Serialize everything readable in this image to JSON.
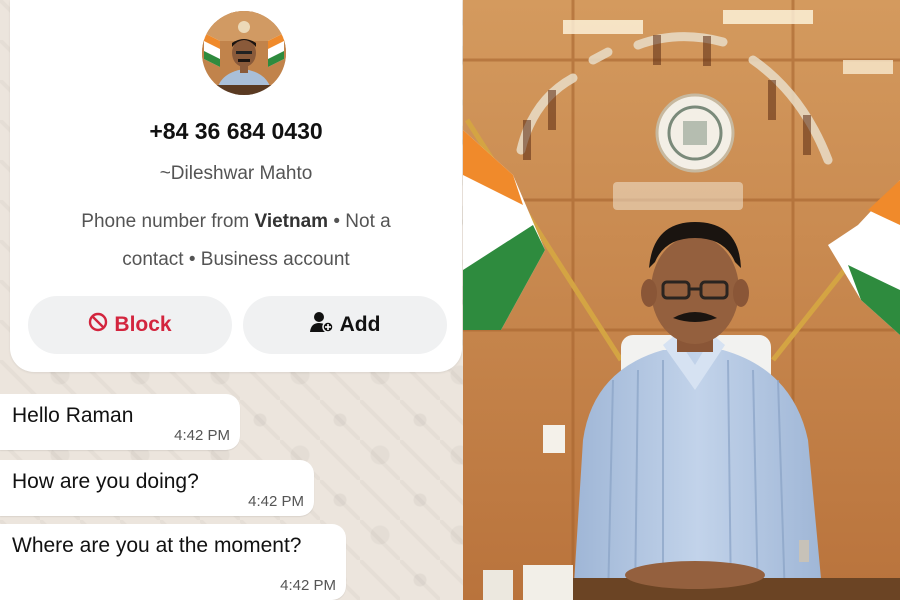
{
  "contact": {
    "phone": "+84 36 684 0430",
    "name": "~Dileshwar Mahto",
    "info_prefix": "Phone number from ",
    "country": "Vietnam",
    "info_suffix": " • Not a contact • Business account"
  },
  "actions": {
    "block_label": "Block",
    "add_label": "Add"
  },
  "messages": [
    {
      "text": "Hello Raman",
      "time": "4:42 PM"
    },
    {
      "text": "How are you doing?",
      "time": "4:42 PM"
    },
    {
      "text": "Where are you at the moment?",
      "time": "4:42 PM"
    }
  ],
  "colors": {
    "block_red": "#d3253e",
    "chat_background": "#ece5dd",
    "button_bg": "#f0f1f2"
  },
  "icons": [
    "block-icon",
    "add-contact-icon"
  ]
}
